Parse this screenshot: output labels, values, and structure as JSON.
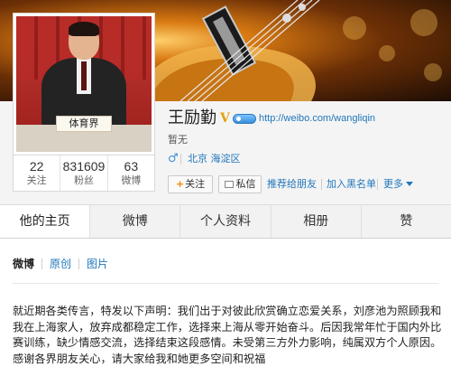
{
  "profile": {
    "name": "王励勤",
    "verified_badge": "V",
    "url": "http://weibo.com/wangliqin",
    "bio": "暂无",
    "gender_icon": "♂",
    "location": "北京 海淀区",
    "nameplate": "体育界"
  },
  "stats": [
    {
      "count": "22",
      "label": "关注"
    },
    {
      "count": "831609",
      "label": "粉丝"
    },
    {
      "count": "63",
      "label": "微博"
    }
  ],
  "actions": {
    "follow_plus": "+",
    "follow": "关注",
    "message": "私信",
    "recommend": "推荐给朋友",
    "blacklist": "加入黑名单",
    "more": "更多"
  },
  "tabs": [
    {
      "label": "他的主页",
      "active": true
    },
    {
      "label": "微博",
      "active": false
    },
    {
      "label": "个人资料",
      "active": false
    },
    {
      "label": "相册",
      "active": false
    },
    {
      "label": "赞",
      "active": false
    }
  ],
  "feed_filters": [
    {
      "label": "微博",
      "active": true
    },
    {
      "label": "原创",
      "active": false
    },
    {
      "label": "图片",
      "active": false
    }
  ],
  "post": {
    "text": "就近期各类传言，特发以下声明：我们出于对彼此欣赏确立恋爱关系，刘彦池为照顾我和我在上海家人，放弃成都稳定工作，选择来上海从零开始奋斗。后因我常年忙于国内外比赛训练，缺少情感交流，选择结束这段感情。未受第三方外力影响，纯属双方个人原因。感谢各界朋友关心，请大家给我和她更多空间和祝福"
  },
  "colors": {
    "link": "#2277bb",
    "verified": "#e2a10d",
    "follow_plus": "#f08a00"
  },
  "icons": {
    "verified": "verified-v-icon",
    "level": "level-icon",
    "gender": "male-icon",
    "message": "envelope-icon",
    "more": "chevron-down-icon"
  }
}
